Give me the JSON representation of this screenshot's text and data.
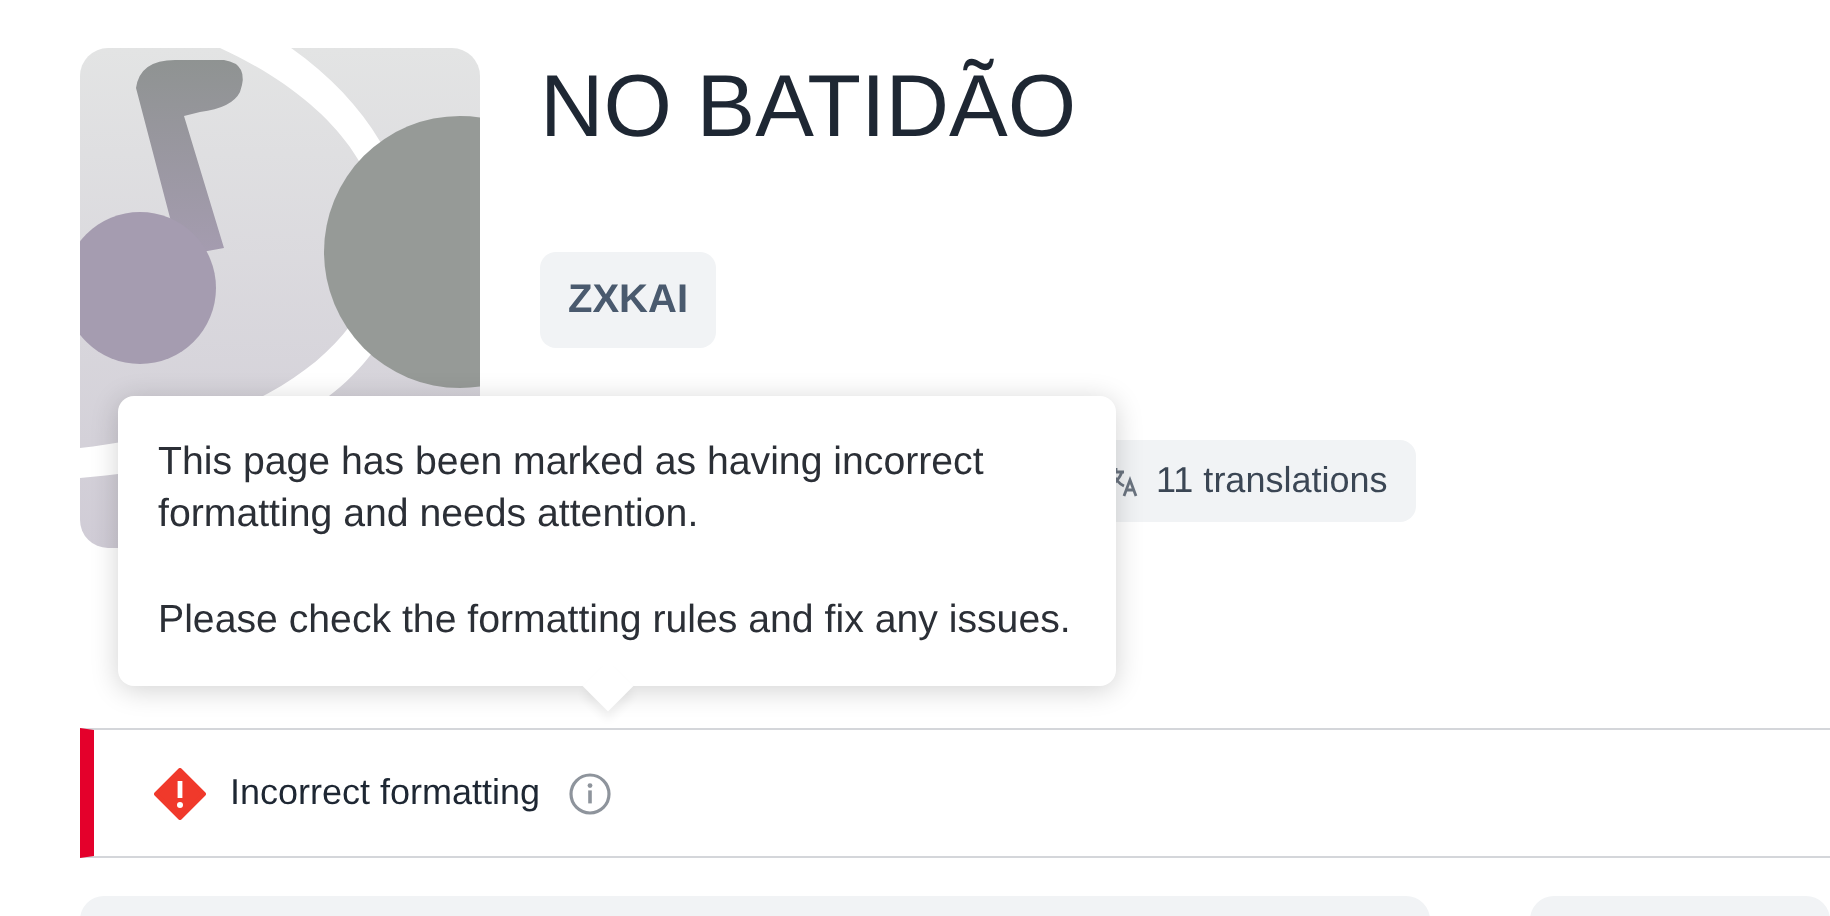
{
  "song": {
    "title": "NO BATIDÃO",
    "artist": "ZXKAI",
    "translations": "11 translations"
  },
  "tooltip": {
    "paragraphs": [
      "This page has been marked as having incorrect formatting and needs attention.",
      "Please check the formatting rules and fix any issues."
    ]
  },
  "alert": {
    "label": "Incorrect formatting",
    "color": "#f0392b"
  }
}
